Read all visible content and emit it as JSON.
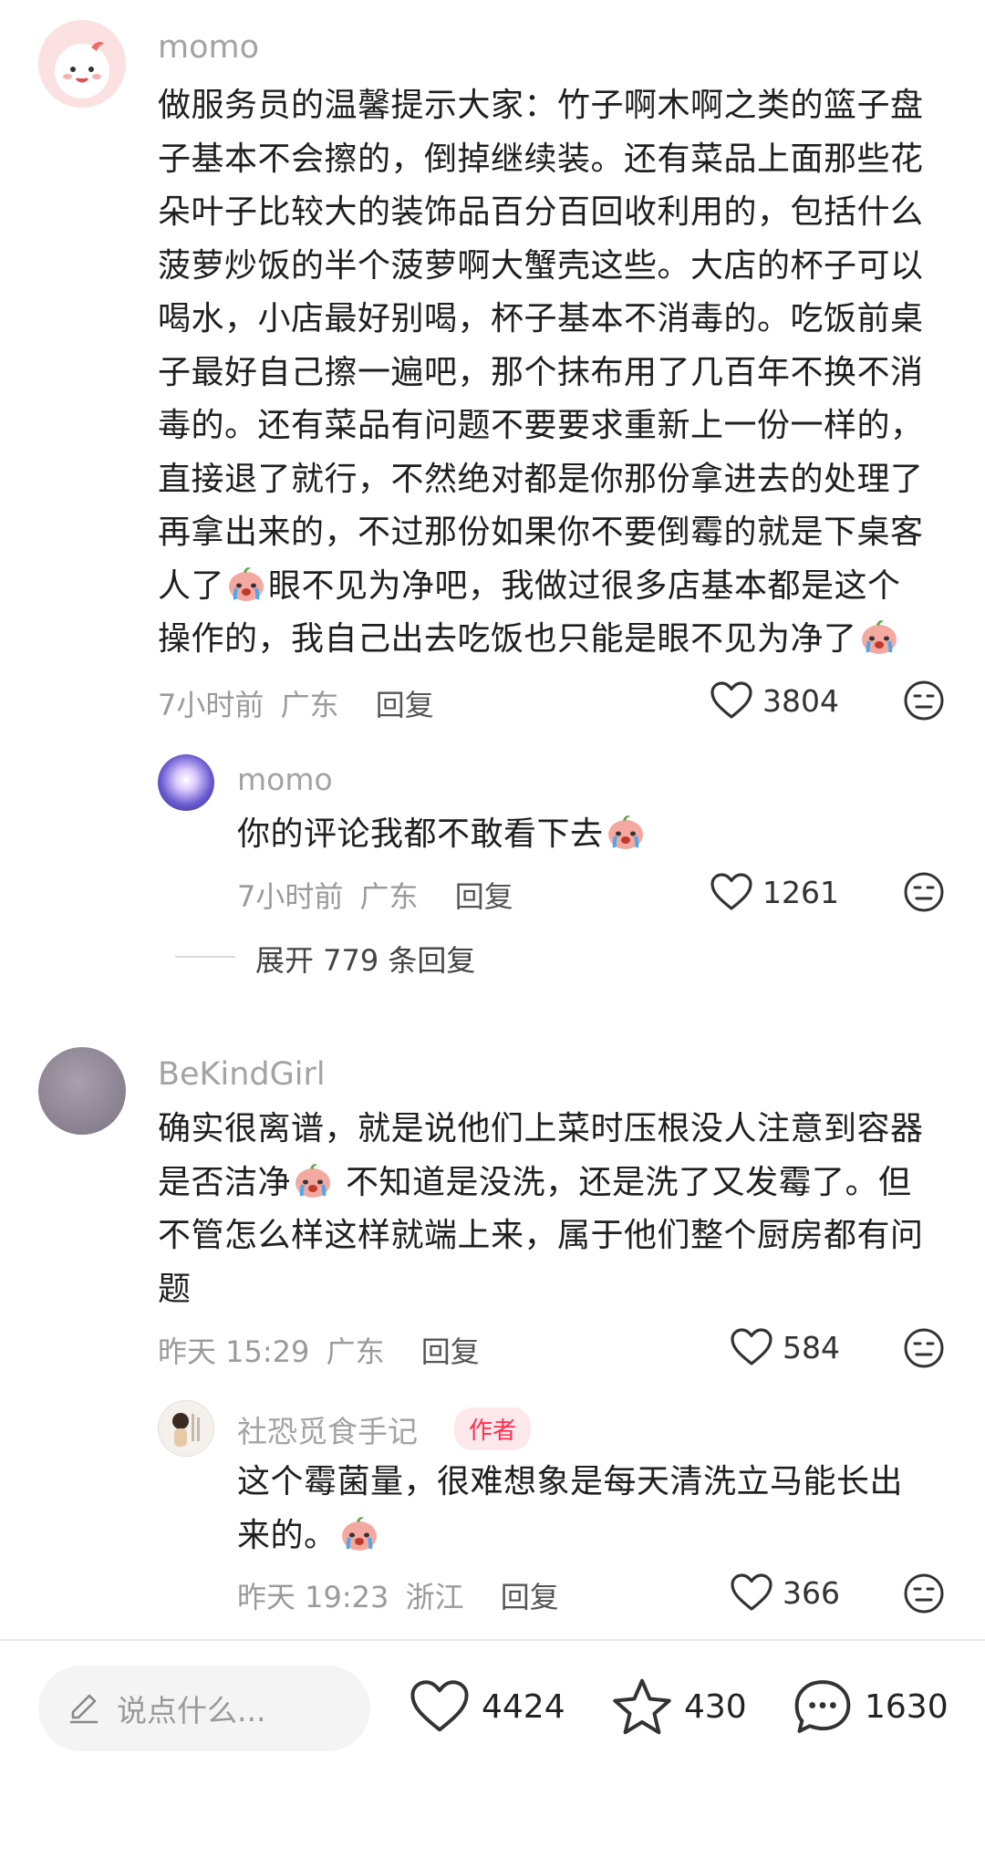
{
  "comments": [
    {
      "username": "momo",
      "lines": [
        "做服务员的温馨提示大家：竹子啊木啊之类的篮子盘",
        "子基本不会擦的，倒掉继续装。还有菜品上面那些花",
        "朵叶子比较大的装饰品百分百回收利用的，包括什么",
        "菠萝炒饭的半个菠萝啊大蟹壳这些。大店的杯子可以",
        "喝水，小店最好别喝，杯子基本不消毒的。吃饭前桌",
        "子最好自己擦一遍吧，那个抹布用了几百年不换不消",
        "毒的。还有菜品有问题不要要求重新上一份一样的，",
        "直接退了就行，不然绝对都是你那份拿进去的处理了",
        "再拿出来的，不过那份如果你不要倒霉的就是下桌客",
        "人了",
        "眼不见为净吧，我做过很多店基本都是这个",
        "操作的，我自己出去吃饭也只能是眼不见为净了"
      ],
      "time": "7小时前",
      "location": "广东",
      "reply": "回复",
      "likes": "3804"
    },
    {
      "username": "momo",
      "text": "你的评论我都不敢看下去",
      "time": "7小时前",
      "location": "广东",
      "reply": "回复",
      "likes": "1261"
    },
    {
      "username": "BeKindGirl",
      "lines": [
        "确实很离谱，就是说他们上菜时压根没人注意到容器",
        "是否洁净",
        " 不知道是没洗，还是洗了又发霉了。但",
        "不管怎么样这样就端上来，属于他们整个厨房都有问",
        "题"
      ],
      "time": "昨天 15:29",
      "location": "广东",
      "reply": "回复",
      "likes": "584"
    },
    {
      "username": "社恐觅食手记",
      "badge": "作者",
      "lines": [
        "这个霉菌量，很难想象是每天清洗立马能长出",
        "来的。"
      ],
      "time": "昨天 19:23",
      "location": "浙江",
      "reply": "回复",
      "likes": "366"
    }
  ],
  "expand_replies": "展开 779 条回复",
  "bottom_bar": {
    "input_placeholder": "说点什么...",
    "likes": "4424",
    "favorites": "430",
    "comments": "1630"
  },
  "colors": {
    "accent": "#ff2e4d",
    "muted": "#9a9a9a",
    "text": "#1f1f1f"
  }
}
